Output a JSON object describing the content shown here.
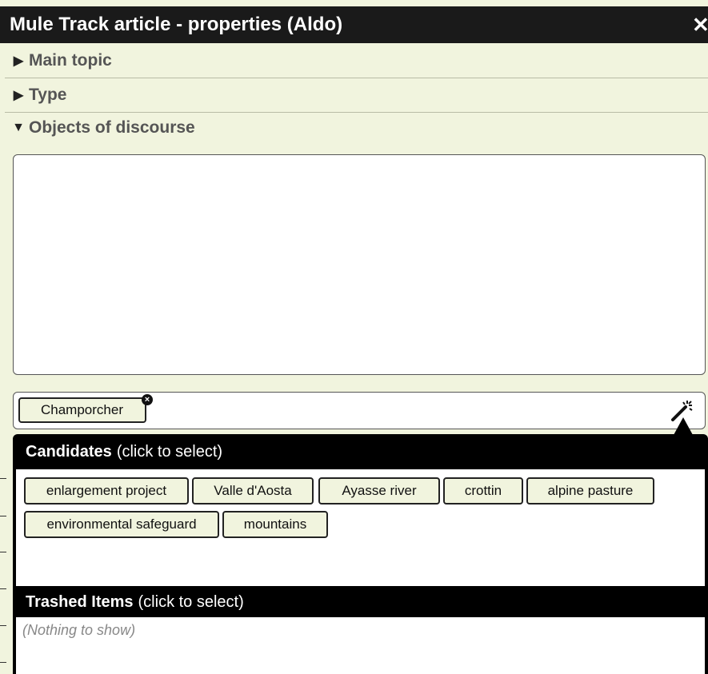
{
  "window": {
    "title": "Mule Track article - properties (Aldo)",
    "close_glyph": "✕"
  },
  "sections": {
    "main_topic": "Main topic",
    "type": "Type",
    "objects_of_discourse": "Objects of discourse"
  },
  "objects": {
    "tags": [
      "Champorcher"
    ],
    "tool_icon": "magic-wand-icon"
  },
  "candidates": {
    "heading_bold": "Candidates",
    "heading_hint": "(click to select)",
    "items": [
      "enlargement project",
      "Valle d'Aosta",
      "Ayasse river",
      "crottin",
      "alpine pasture",
      "environmental safeguard",
      "mountains"
    ]
  },
  "trashed": {
    "heading_bold": "Trashed Items",
    "heading_hint": "(click to select)",
    "empty_text": "(Nothing to show)"
  }
}
